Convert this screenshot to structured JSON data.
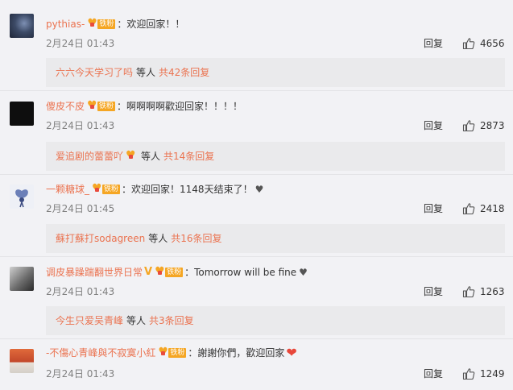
{
  "comments": [
    {
      "username": "pythias-",
      "badge": "铁粉",
      "text": "：欢迎回家！！",
      "time": "2月24日 01:43",
      "reply_label": "回复",
      "likes": "4656",
      "sub_user": "六六今天学习了吗",
      "sub_mid": "等人",
      "sub_total": "共42条回复"
    },
    {
      "username": "傻皮不皮",
      "badge": "铁粉",
      "text": "：啊啊啊啊歡迎回家！！！！",
      "time": "2月24日 01:43",
      "reply_label": "回复",
      "likes": "2873",
      "sub_user": "爱追剧的蕾蕾吖",
      "sub_mid": "等人",
      "sub_total": "共14条回复",
      "sub_badge": true
    },
    {
      "username": "一颗糖球_",
      "badge": "铁粉",
      "text": "：欢迎回家！1148天结束了！",
      "time": "2月24日 01:45",
      "reply_label": "回复",
      "likes": "2418",
      "sub_user": "蘇打蘇打sodagreen",
      "sub_mid": "等人",
      "sub_total": "共16条回复"
    },
    {
      "username": "调皮暴躁踹翻世界日常",
      "badge": "铁粉",
      "text": "：Tomorrow will be fine",
      "time": "2月24日 01:43",
      "reply_label": "回复",
      "likes": "1263",
      "sub_user": "今生只爱吴青峰",
      "sub_mid": "等人",
      "sub_total": "共3条回复"
    },
    {
      "username": "-不傷心青峰與不寂寞小紅",
      "badge": "铁粉",
      "text": "：謝謝你們，歡迎回家",
      "time": "2月24日 01:43",
      "reply_label": "回复",
      "likes": "1249"
    }
  ],
  "icons": {
    "thumb": "thumbs-up-icon",
    "fan_badge": "fan-heart-icon",
    "vip": "vip-v-icon",
    "heart_emoji": "heart-emoji-icon"
  },
  "colors": {
    "username": "#eb7350",
    "badge": "#f5a623",
    "time": "#808080",
    "background": "#f2f2f5",
    "subbox": "#eaeaec"
  }
}
